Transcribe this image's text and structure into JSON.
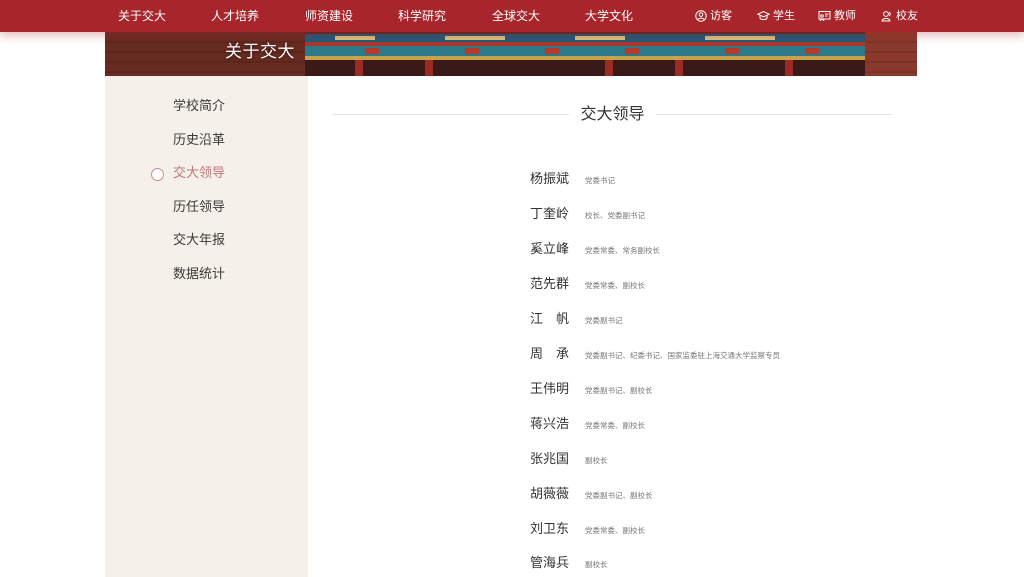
{
  "topnav": {
    "items": [
      {
        "label": "关于交大"
      },
      {
        "label": "人才培养"
      },
      {
        "label": "师资建设"
      },
      {
        "label": "科学研究"
      },
      {
        "label": "全球交大"
      },
      {
        "label": "大学文化"
      }
    ],
    "right": [
      {
        "label": "访客",
        "icon": "user-circle-icon"
      },
      {
        "label": "学生",
        "icon": "graduation-cap-icon"
      },
      {
        "label": "教师",
        "icon": "teacher-board-icon"
      },
      {
        "label": "校友",
        "icon": "alumni-users-icon"
      }
    ]
  },
  "banner": {
    "title": "关于交大"
  },
  "sidebar": {
    "items": [
      {
        "label": "学校简介"
      },
      {
        "label": "历史沿革"
      },
      {
        "label": "交大领导",
        "active": true
      },
      {
        "label": "历任领导"
      },
      {
        "label": "交大年报"
      },
      {
        "label": "数据统计"
      }
    ]
  },
  "main": {
    "section_title": "交大领导",
    "leaders": [
      {
        "name": "杨振斌",
        "title": "党委书记"
      },
      {
        "name": "丁奎岭",
        "title": "校长、党委副书记"
      },
      {
        "name": "奚立峰",
        "title": "党委常委、常务副校长"
      },
      {
        "name": "范先群",
        "title": "党委常委、副校长"
      },
      {
        "name": "江　帆",
        "title": "党委副书记"
      },
      {
        "name": "周　承",
        "title": "党委副书记、纪委书记、国家监委驻上海交通大学监察专员"
      },
      {
        "name": "王伟明",
        "title": "党委副书记、副校长"
      },
      {
        "name": "蒋兴浩",
        "title": "党委常委、副校长"
      },
      {
        "name": "张兆国",
        "title": "副校长"
      },
      {
        "name": "胡薇薇",
        "title": "党委副书记、副校长"
      },
      {
        "name": "刘卫东",
        "title": "党委常委、副校长"
      },
      {
        "name": "管海兵",
        "title": "副校长"
      }
    ]
  },
  "colors": {
    "primary_red": "#a8262b",
    "sidebar_bg": "#f5f0ea",
    "active_text": "#c0787a"
  }
}
